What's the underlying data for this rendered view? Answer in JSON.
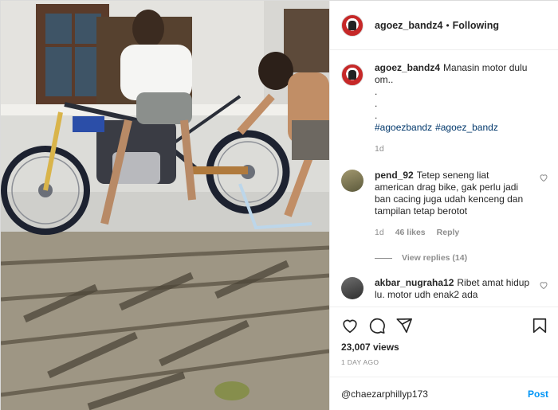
{
  "post": {
    "author": "agoez_bandz4",
    "separator": "•",
    "follow_status": "Following"
  },
  "caption": {
    "username": "agoez_bandz4",
    "text": "Manasin motor dulu om..",
    "dots": [
      ".",
      ".",
      "."
    ],
    "hashtags": [
      "#agoezbandz",
      "#agoez_bandz"
    ],
    "time": "1d"
  },
  "comments": [
    {
      "username": "pend_92",
      "text": "Tetep seneng liat american drag bike, gak perlu jadi ban cacing juga udah kenceng dan tampilan tetap berotot",
      "time": "1d",
      "likes": "46 likes",
      "reply_label": "Reply",
      "view_replies": "View replies (14)"
    },
    {
      "username": "akbar_nugraha12",
      "text": "Ribet amat hidup lu. motor udh enak2 ada"
    }
  ],
  "stats": {
    "views": "23,007 views",
    "posted": "1 DAY AGO"
  },
  "add_comment": {
    "value": "@chaezarphillyp173",
    "post_label": "Post"
  },
  "colors": {
    "link": "#00376b",
    "post_button": "#0095f6",
    "secondary_text": "#8e8e8e"
  },
  "icons": [
    "heart-icon",
    "comment-icon",
    "share-icon",
    "bookmark-icon"
  ]
}
